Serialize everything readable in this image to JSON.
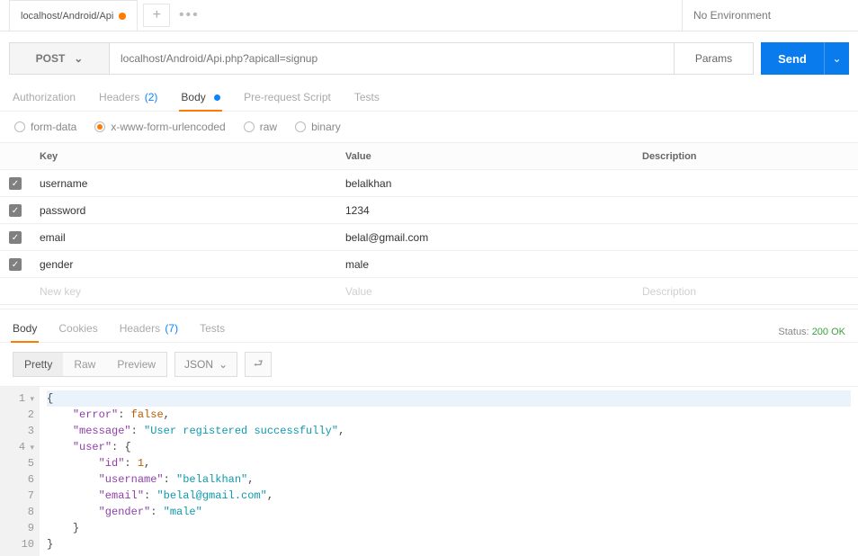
{
  "topbar": {
    "tab_title": "localhost/Android/Api",
    "env": "No Environment"
  },
  "request": {
    "method": "POST",
    "url": "localhost/Android/Api.php?apicall=signup",
    "params_label": "Params",
    "send_label": "Send"
  },
  "req_tabs": {
    "authorization": "Authorization",
    "headers": "Headers",
    "headers_count": "(2)",
    "body": "Body",
    "prerequest": "Pre-request Script",
    "tests": "Tests"
  },
  "body_types": {
    "formdata": "form-data",
    "urlencoded": "x-www-form-urlencoded",
    "raw": "raw",
    "binary": "binary"
  },
  "params_table": {
    "head_key": "Key",
    "head_value": "Value",
    "head_desc": "Description",
    "rows": [
      {
        "key": "username",
        "value": "belalkhan"
      },
      {
        "key": "password",
        "value": "1234"
      },
      {
        "key": "email",
        "value": "belal@gmail.com"
      },
      {
        "key": "gender",
        "value": "male"
      }
    ],
    "placeholder_key": "New key",
    "placeholder_value": "Value",
    "placeholder_desc": "Description"
  },
  "resp_tabs": {
    "body": "Body",
    "cookies": "Cookies",
    "headers": "Headers",
    "headers_count": "(7)",
    "tests": "Tests",
    "status_label": "Status:",
    "status_code": "200 OK"
  },
  "resp_toolbar": {
    "pretty": "Pretty",
    "raw": "Raw",
    "preview": "Preview",
    "format": "JSON"
  },
  "response_json": {
    "error": false,
    "message": "User registered successfully",
    "user": {
      "id": 1,
      "username": "belalkhan",
      "email": "belal@gmail.com",
      "gender": "male"
    }
  },
  "code_lines": {
    "n1": "1",
    "n2": "2",
    "n3": "3",
    "n4": "4",
    "n5": "5",
    "n6": "6",
    "n7": "7",
    "n8": "8",
    "n9": "9",
    "n10": "10"
  }
}
